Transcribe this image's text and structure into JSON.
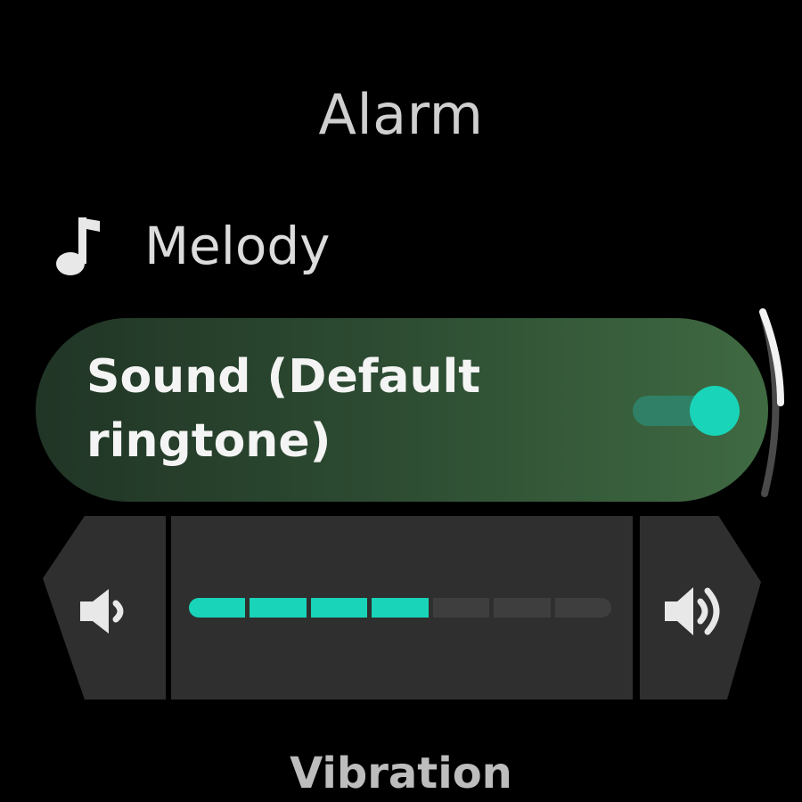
{
  "screen": {
    "title": "Alarm"
  },
  "melody": {
    "label": "Melody",
    "icon": "music-note-icon"
  },
  "sound": {
    "label": "Sound (Default\nringtone)",
    "toggle_on": true,
    "accent_color": "#19d4b8"
  },
  "volume": {
    "level": 4,
    "max": 7,
    "decrease_icon": "volume-low-icon",
    "increase_icon": "volume-high-icon"
  },
  "vibration": {
    "label": "Vibration"
  },
  "scroll": {
    "indicator_icon": "scroll-indicator"
  }
}
